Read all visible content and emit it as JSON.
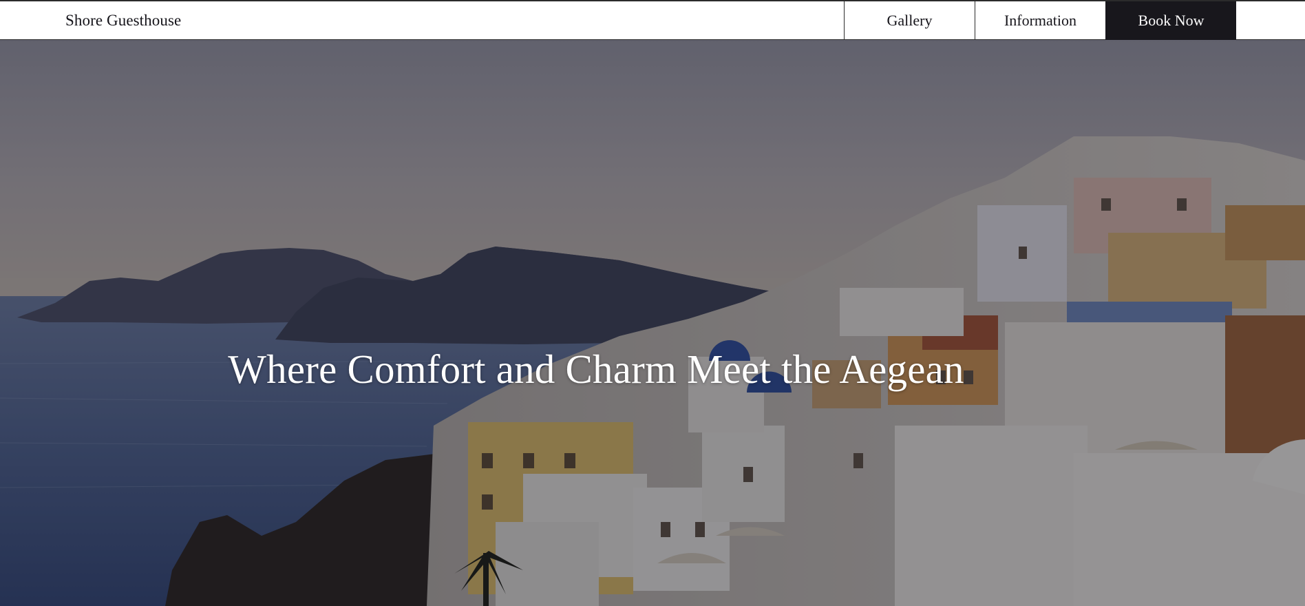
{
  "nav": {
    "brand": "Shore Guesthouse",
    "links": [
      {
        "label": "Gallery"
      },
      {
        "label": "Information"
      },
      {
        "label": "Book Now"
      }
    ]
  },
  "hero": {
    "headline": "Where Comfort and Charm Meet the Aegean",
    "image_subject": "Whitewashed cliffside village above the sea at dusk",
    "overlay_color": "#14121c"
  },
  "colors": {
    "nav_background": "#ffffff",
    "nav_text": "#15141a",
    "book_button_background": "#18171c",
    "book_button_text": "#ffffff",
    "headline_text": "#ffffff"
  }
}
